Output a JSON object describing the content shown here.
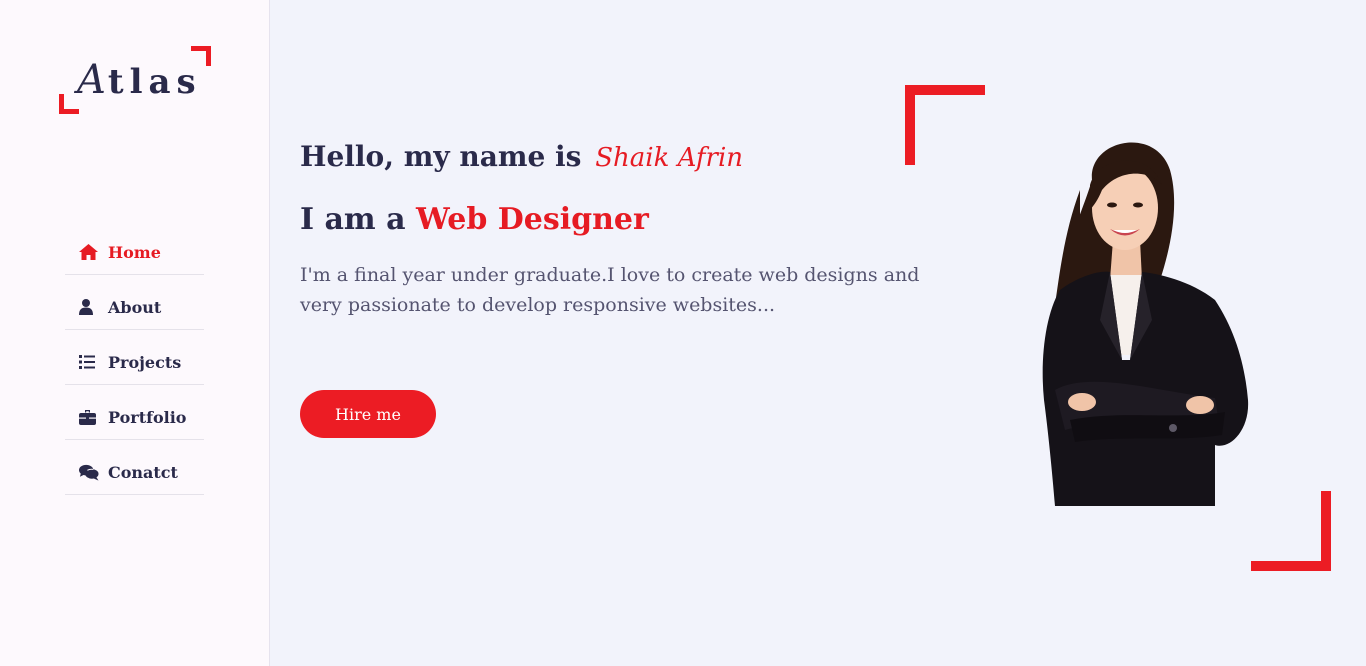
{
  "logo": {
    "first_letter": "A",
    "rest": "tlas"
  },
  "nav": {
    "items": [
      {
        "label": "Home",
        "icon": "home-icon",
        "active": true
      },
      {
        "label": "About",
        "icon": "user-icon",
        "active": false
      },
      {
        "label": "Projects",
        "icon": "list-icon",
        "active": false
      },
      {
        "label": "Portfolio",
        "icon": "briefcase-icon",
        "active": false
      },
      {
        "label": "Conatct",
        "icon": "comments-icon",
        "active": false
      }
    ]
  },
  "hero": {
    "greeting_prefix": "Hello, my name is",
    "name": "Shaik Afrin",
    "role_prefix": "I am a",
    "role": "Web Designer",
    "description": "I'm a final year under graduate.I love to create web designs and very passionate to develop responsive websites...",
    "cta_label": "Hire me"
  },
  "colors": {
    "accent": "#ec1c24",
    "text_dark": "#2a2a4a",
    "background": "#f2f3fb",
    "sidebar": "#fdf9fd"
  }
}
